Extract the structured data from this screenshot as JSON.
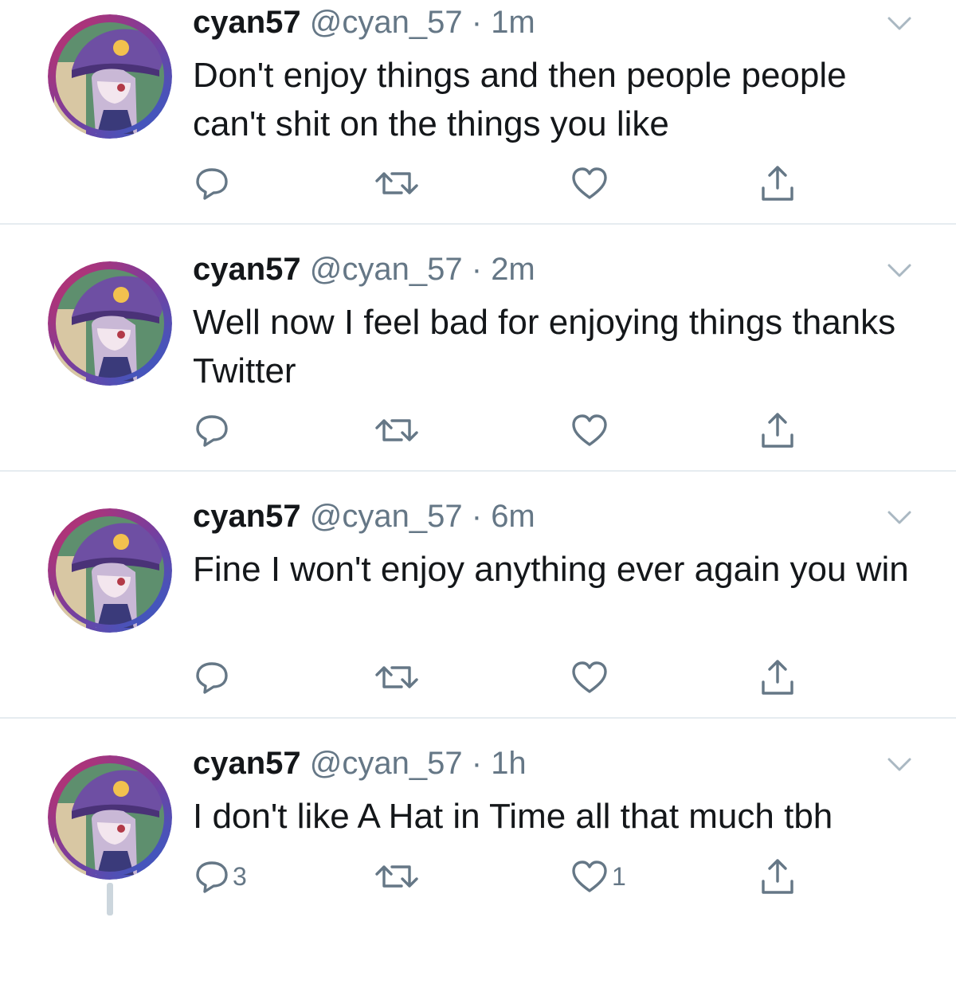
{
  "colors": {
    "text": "#14171a",
    "secondary": "#657786",
    "divider": "#e6ecf0",
    "thread_line": "#ccd6dd"
  },
  "icons": {
    "reply": "reply-icon",
    "retweet": "retweet-icon",
    "like": "heart-icon",
    "share": "share-icon",
    "more": "chevron-down-icon"
  },
  "tweets": [
    {
      "name": "cyan57",
      "handle": "@cyan_57",
      "sep": " · ",
      "time": "1m",
      "text": "Don't enjoy things and then people people can't shit on the things you like",
      "replies": "",
      "likes": ""
    },
    {
      "name": "cyan57",
      "handle": "@cyan_57",
      "sep": " · ",
      "time": "2m",
      "text": "Well now I feel bad for enjoying things thanks Twitter",
      "replies": "",
      "likes": ""
    },
    {
      "name": "cyan57",
      "handle": "@cyan_57",
      "sep": " · ",
      "time": "6m",
      "text": "Fine I won't enjoy anything ever again you win",
      "replies": "",
      "likes": ""
    },
    {
      "name": "cyan57",
      "handle": "@cyan_57",
      "sep": " · ",
      "time": "1h",
      "text": "I don't like A Hat in Time all that much tbh",
      "replies": "3",
      "likes": "1"
    }
  ]
}
